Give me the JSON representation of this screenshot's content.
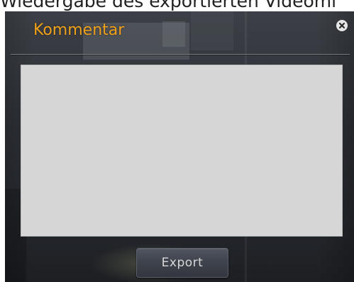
{
  "page": {
    "heading": "Wiedergabe des exportierten Videomi"
  },
  "dialog": {
    "title": "Kommentar",
    "close_icon": "close-circle-icon",
    "comment": {
      "value": "",
      "placeholder": ""
    },
    "export_label": "Export"
  },
  "colors": {
    "title": "#f0a21a",
    "dialog_background": "#2d3036",
    "comment_field": "#d6d6d6",
    "button": "#3e424b",
    "button_text": "#d8d8d8"
  }
}
